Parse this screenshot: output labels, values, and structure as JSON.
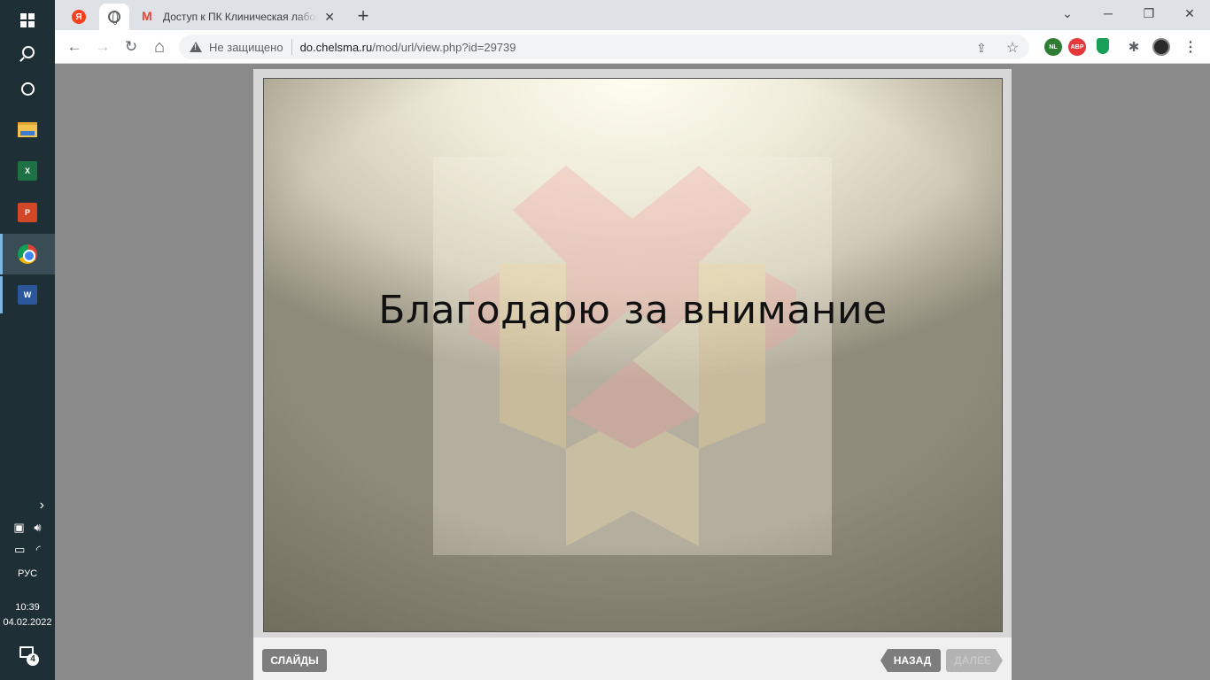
{
  "taskbar": {
    "apps": [
      "start",
      "search",
      "cortana",
      "file-explorer",
      "excel",
      "powerpoint",
      "chrome",
      "word"
    ],
    "language": "РУС",
    "time": "10:39",
    "date": "04.02.2022",
    "notification_count": "4"
  },
  "browser": {
    "pinned_tabs": [
      {
        "icon": "yandex-icon",
        "glyph": "Я"
      },
      {
        "icon": "globe-icon"
      }
    ],
    "active_tab": {
      "title": "Доступ к ПК Клиническая лабор",
      "close": "✕"
    },
    "new_tab": "+",
    "window_controls": {
      "minimize": "─",
      "restore": "❐",
      "close": "✕",
      "tab_search": "⌄"
    },
    "nav": {
      "back": "←",
      "forward": "→",
      "reload": "↻",
      "home": "⌂"
    },
    "omnibox": {
      "security_label": "Не защищено",
      "url_host": "do.chelsma.ru",
      "url_path": "/mod/url/view.php?id=29739"
    },
    "extensions": [
      {
        "name": "nl-extension-icon",
        "label": "NL",
        "color": "#2e7d32"
      },
      {
        "name": "adblock-plus-icon",
        "label": "ABP",
        "color": "#e5383b"
      },
      {
        "name": "shield-extension-icon",
        "label": "",
        "color": "#18a058"
      }
    ]
  },
  "player": {
    "slide_title": "Благодарю за внимание",
    "slides_button": "СЛАЙДЫ",
    "back_button": "НАЗАД",
    "next_button": "ДАЛЕЕ",
    "next_enabled": false
  }
}
